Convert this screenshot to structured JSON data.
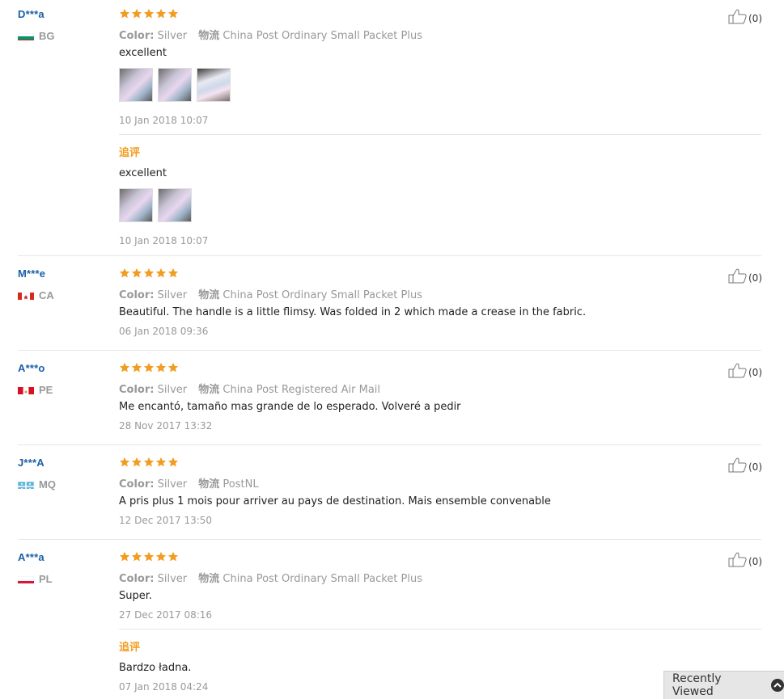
{
  "meta_labels": {
    "color_label": "Color:",
    "shipping_label": "物流"
  },
  "append_label": "追评",
  "reviews": [
    {
      "user": "D***a",
      "country": "BG",
      "color": "Silver",
      "shipping": "China Post Ordinary Small Packet Plus",
      "text": "excellent",
      "date": "10 Jan 2018 10:07",
      "useful": "(0)",
      "photos": 3,
      "followup": {
        "text": "excellent",
        "date": "10 Jan 2018 10:07",
        "photos": 2
      }
    },
    {
      "user": "M***e",
      "country": "CA",
      "color": "Silver",
      "shipping": "China Post Ordinary Small Packet Plus",
      "text": "Beautiful. The handle is a little flimsy. Was folded in 2 which made a crease in the fabric.",
      "date": "06 Jan 2018 09:36",
      "useful": "(0)"
    },
    {
      "user": "A***o",
      "country": "PE",
      "color": "Silver",
      "shipping": "China Post Registered Air Mail",
      "text": "Me encantó, tamaño mas grande de lo esperado. Volveré a pedir",
      "date": "28 Nov 2017 13:32",
      "useful": "(0)"
    },
    {
      "user": "J***A",
      "country": "MQ",
      "color": "Silver",
      "shipping": "PostNL",
      "text": "A pris plus 1 mois pour arriver au pays de destination. Mais ensemble convenable",
      "date": "12 Dec 2017 13:50",
      "useful": "(0)"
    },
    {
      "user": "A***a",
      "country": "PL",
      "color": "Silver",
      "shipping": "China Post Ordinary Small Packet Plus",
      "text": "Super.",
      "date": "27 Dec 2017 08:16",
      "useful": "(0)",
      "followup": {
        "text": "Bardzo ładna.",
        "date": "07 Jan 2018 04:24"
      }
    }
  ],
  "rating_stars": 5,
  "recently_viewed": {
    "label": "Recently Viewed",
    "icon": "chevron-up-icon"
  },
  "colors": {
    "star": "#f29c20",
    "user_link": "#1a5fa8",
    "append_label": "#f29c20"
  }
}
